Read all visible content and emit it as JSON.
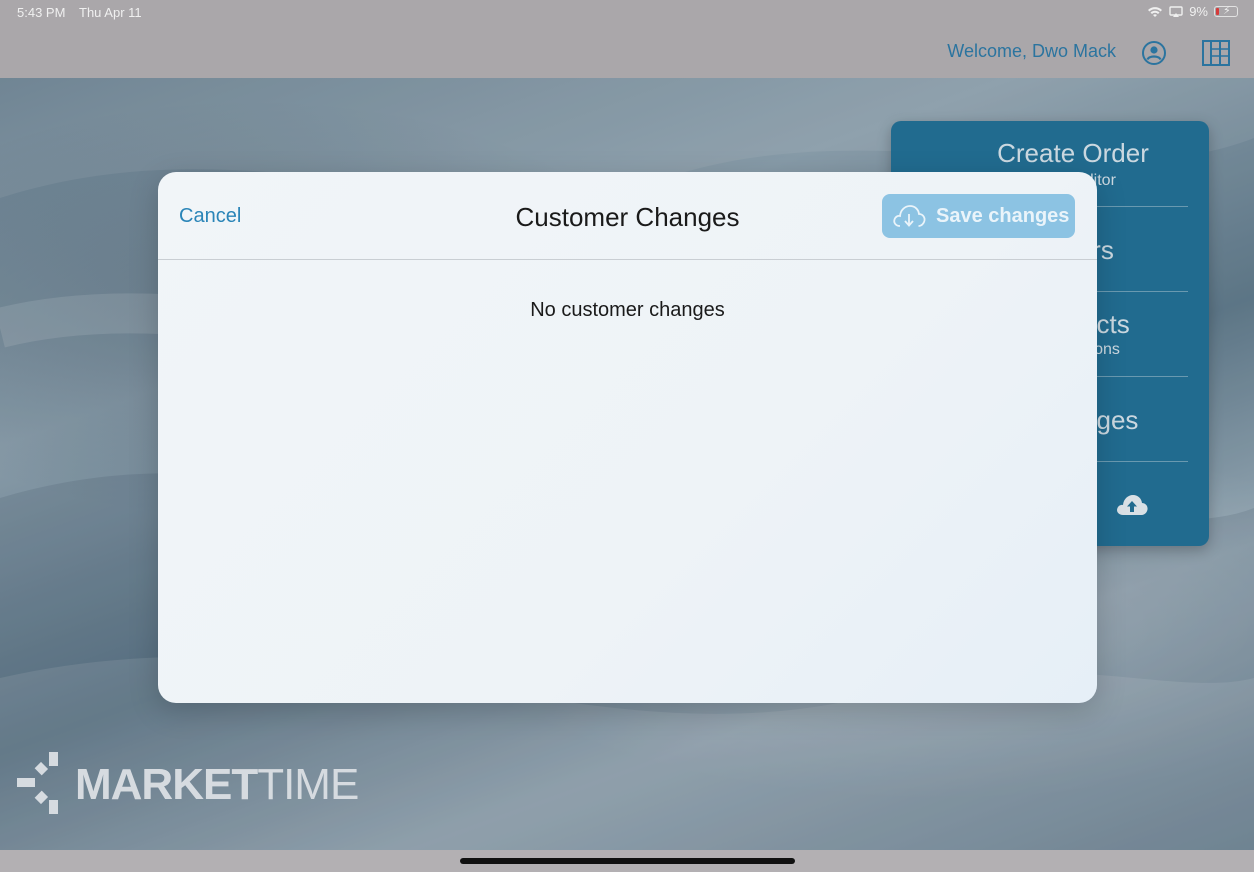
{
  "status_bar": {
    "time": "5:43 PM",
    "date": "Thu Apr 11",
    "battery": "9%",
    "icons": [
      "wifi-icon",
      "screen-mirroring-icon",
      "battery-charging-icon"
    ]
  },
  "nav": {
    "welcome": "Welcome, Dwo Mack",
    "icons": [
      "profile-icon",
      "layout-grid-icon"
    ]
  },
  "side_menu": {
    "items": [
      {
        "title": "Create Order",
        "subtitle": "litor"
      },
      {
        "title": "rs",
        "subtitle": ""
      },
      {
        "title": "lucts",
        "subtitle": "tions"
      },
      {
        "title": "anges",
        "subtitle": ""
      }
    ],
    "sync_icon": "cloud-upload-icon"
  },
  "logo": {
    "bold": "MARKET",
    "thin": "TIME"
  },
  "modal": {
    "cancel_label": "Cancel",
    "title": "Customer Changes",
    "save_label": "Save changes",
    "save_icon": "cloud-download-icon",
    "empty_message": "No customer changes"
  },
  "colors": {
    "accent": "#2a85b8",
    "save_button": "#8cc3e3",
    "menu_background": "#1f6f96"
  }
}
